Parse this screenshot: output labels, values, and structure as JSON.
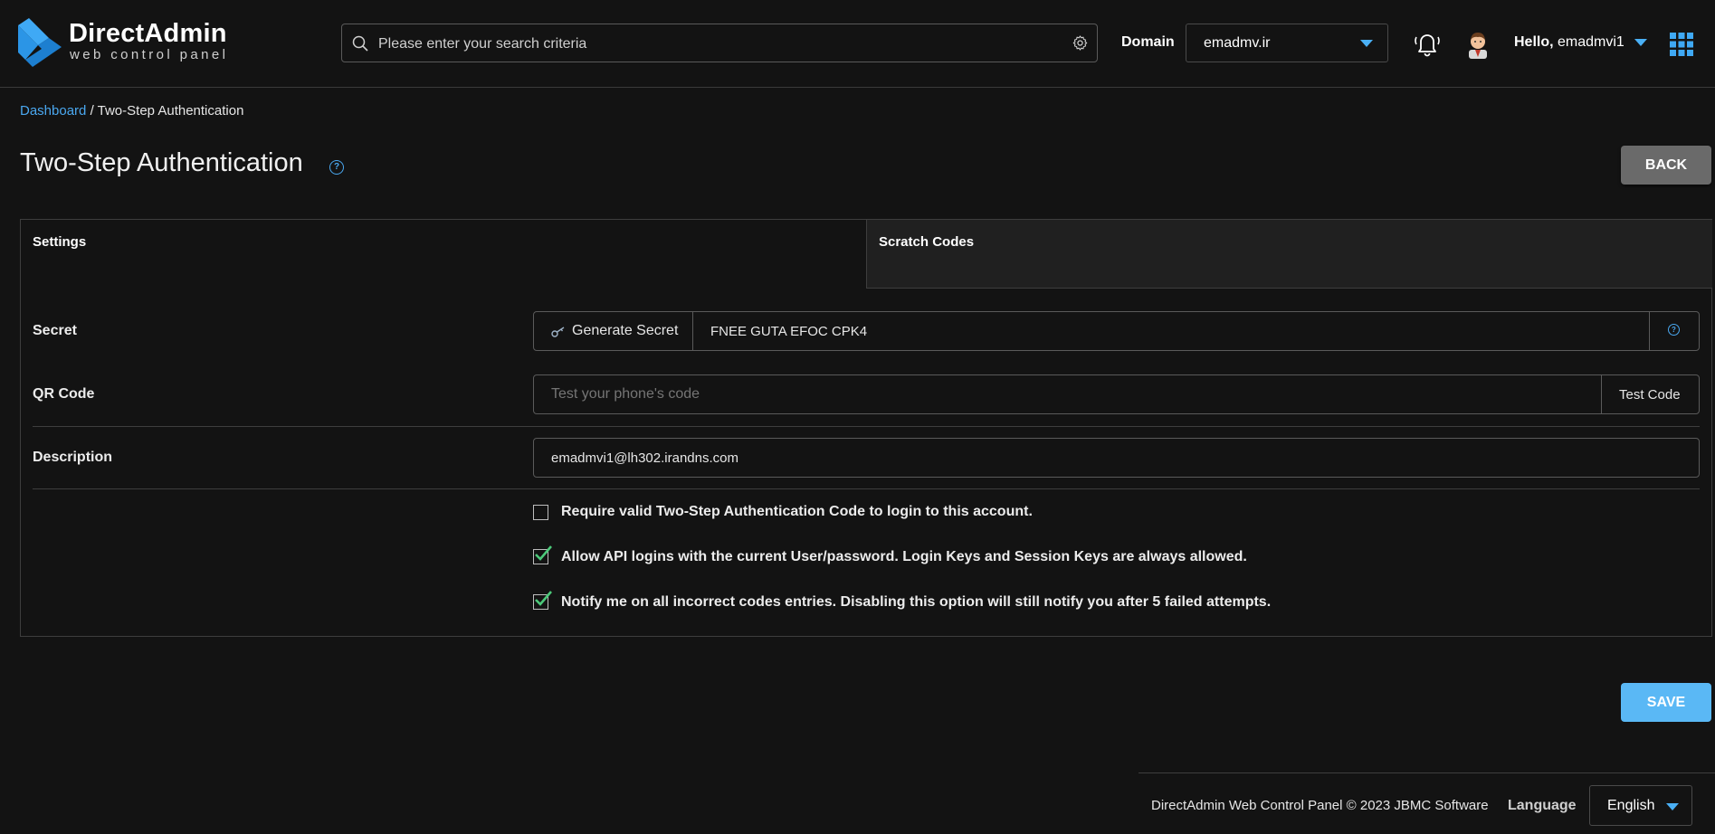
{
  "brand": {
    "name": "DirectAdmin",
    "subtitle": "web control panel",
    "accent": "#3fa9f5"
  },
  "header": {
    "search_placeholder": "Please enter your search criteria",
    "domain_label": "Domain",
    "domain_value": "emadmv.ir",
    "hello_prefix": "Hello,",
    "username": "emadmvi1",
    "icons": [
      "search-icon",
      "gear-icon",
      "bell-icon",
      "avatar",
      "apps-grid-icon"
    ]
  },
  "breadcrumb": {
    "home": "Dashboard",
    "separator": "/",
    "current": "Two-Step Authentication"
  },
  "page": {
    "title": "Two-Step Authentication",
    "back_label": "BACK",
    "save_label": "SAVE"
  },
  "tabs": [
    {
      "label": "Settings",
      "active": true
    },
    {
      "label": "Scratch Codes",
      "active": false
    }
  ],
  "form": {
    "secret_label": "Secret",
    "generate_label": "Generate Secret",
    "secret_value": "FNEE GUTA EFOC CPK4",
    "qr_label": "QR Code",
    "qr_placeholder": "Test your phone's code",
    "test_code_label": "Test Code",
    "description_label": "Description",
    "description_value": "emadmvi1@lh302.irandns.com",
    "checkboxes": [
      {
        "label": "Require valid Two-Step Authentication Code to login to this account.",
        "checked": false
      },
      {
        "label": "Allow API logins with the current User/password. Login Keys and Session Keys are always allowed.",
        "checked": true
      },
      {
        "label": "Notify me on all incorrect codes entries. Disabling this option will still notify you after 5 failed attempts.",
        "checked": true
      }
    ]
  },
  "footer": {
    "copyright": "DirectAdmin Web Control Panel © 2023 JBMC Software",
    "language_label": "Language",
    "language_value": "English"
  }
}
